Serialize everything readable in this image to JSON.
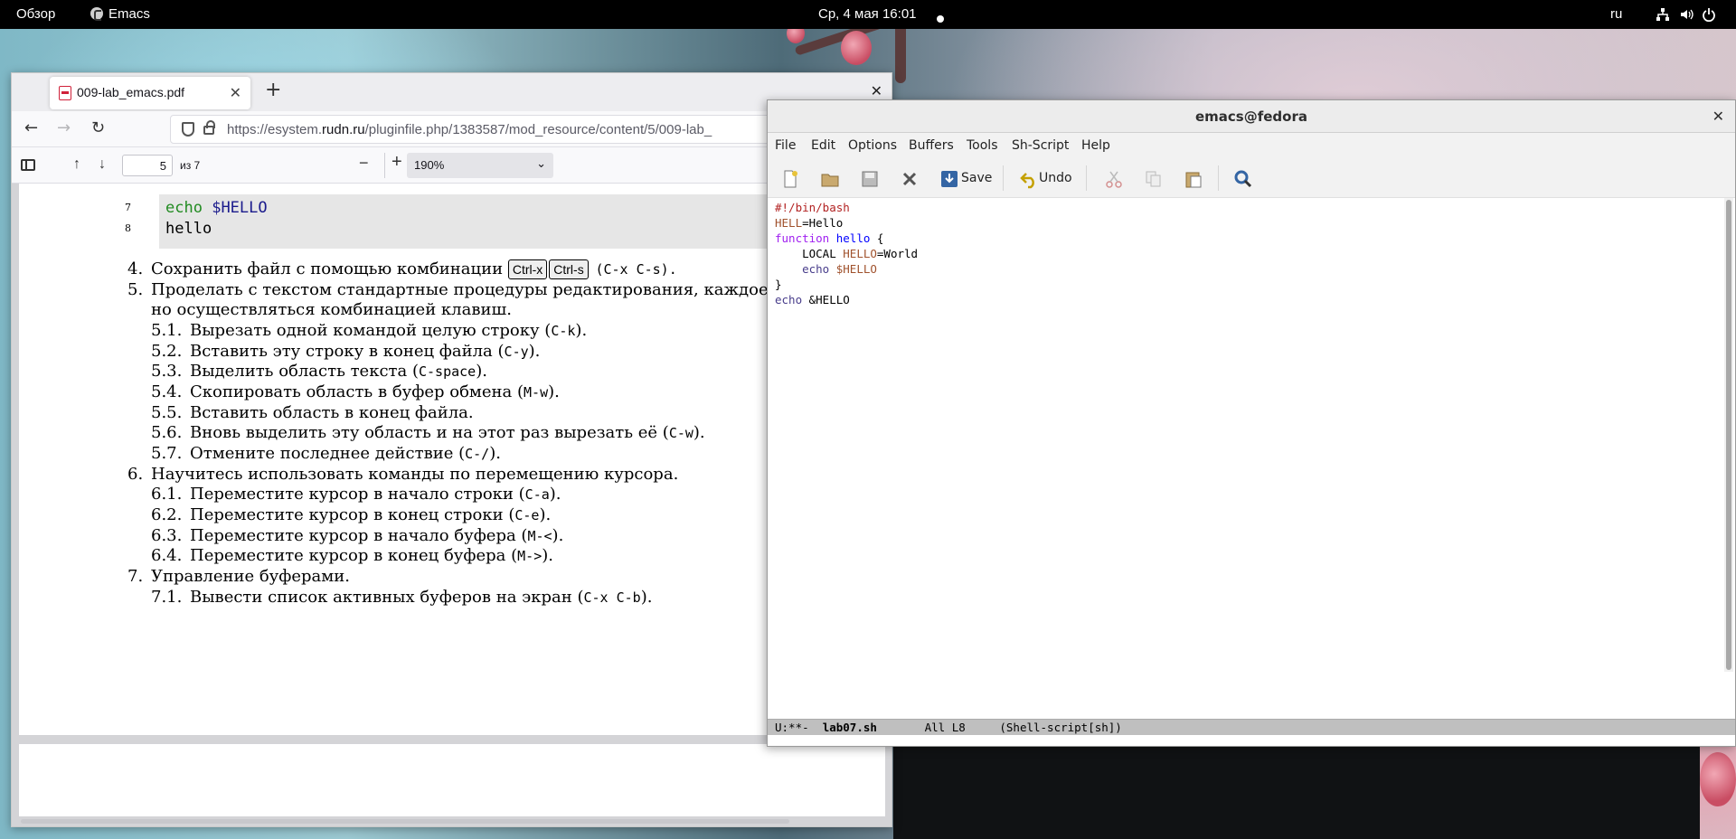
{
  "topbar": {
    "overview": "Обзор",
    "app_name": "Emacs",
    "clock": "Ср, 4 мая  16:01",
    "language": "ru"
  },
  "firefox": {
    "tab_title": "009-lab_emacs.pdf",
    "url_prefix": "https://esystem.",
    "url_domain": "rudn.ru",
    "url_rest": "/pluginfile.php/1383587/mod_resource/content/5/009-lab_",
    "page_number": "5",
    "page_of": "из 7",
    "zoom": "190%"
  },
  "pdf": {
    "code_lines": [
      {
        "num": "7",
        "cmd": "echo",
        "arg": "$HELLO"
      },
      {
        "num": "8",
        "text": "hello"
      }
    ],
    "items": [
      {
        "num": "4.",
        "text": "Сохранить файл с помощью комбинации",
        "keys": [
          "Ctrl-x",
          "Ctrl-s"
        ],
        "code": "(C-x C-s)."
      },
      {
        "num": "5.",
        "text": "Проделать с текстом стандартные процедуры редактирования, каждое дейс",
        "text2": "но осуществляться комбинацией клавиш."
      },
      {
        "num": "5.1.",
        "text": "Вырезать одной командой целую строку (",
        "code": "C-k",
        "tail": ")."
      },
      {
        "num": "5.2.",
        "text": "Вставить эту строку в конец файла (",
        "code": "C-y",
        "tail": ")."
      },
      {
        "num": "5.3.",
        "text": "Выделить область текста (",
        "code": "C-space",
        "tail": ")."
      },
      {
        "num": "5.4.",
        "text": "Скопировать область в буфер обмена (",
        "code": "M-w",
        "tail": ")."
      },
      {
        "num": "5.5.",
        "text": "Вставить область в конец файла."
      },
      {
        "num": "5.6.",
        "text": "Вновь выделить эту область и на этот раз вырезать её (",
        "code": "C-w",
        "tail": ")."
      },
      {
        "num": "5.7.",
        "text": "Отмените последнее действие (",
        "code": "C-/",
        "tail": ")."
      },
      {
        "num": "6.",
        "text": "Научитесь использовать команды по перемещению курсора."
      },
      {
        "num": "6.1.",
        "text": "Переместите курсор в начало строки (",
        "code": "C-a",
        "tail": ")."
      },
      {
        "num": "6.2.",
        "text": "Переместите курсор в конец строки (",
        "code": "C-e",
        "tail": ")."
      },
      {
        "num": "6.3.",
        "text": "Переместите курсор в начало буфера (",
        "code": "M-<",
        "tail": ")."
      },
      {
        "num": "6.4.",
        "text": "Переместите курсор в конец буфера (",
        "code": "M->",
        "tail": ")."
      },
      {
        "num": "7.",
        "text": "Управление буферами."
      },
      {
        "num": "7.1.",
        "text": "Вывести список активных буферов на экран (",
        "code": "C-x C-b",
        "tail": ")."
      }
    ]
  },
  "emacs": {
    "title": "emacs@fedora",
    "menu": [
      "File",
      "Edit",
      "Options",
      "Buffers",
      "Tools",
      "Sh-Script",
      "Help"
    ],
    "toolbar": {
      "save": "Save",
      "undo": "Undo"
    },
    "source": {
      "line1": "#!/bin/bash",
      "l2_var": "HELL",
      "l2_rest": "=Hello",
      "l3_kw": "function",
      "l3_fn": "hello",
      "l3_rest": " {",
      "l4_pre": "    LOCAL ",
      "l4_var": "HELLO",
      "l4_rest": "=World",
      "l5_pre": "    ",
      "l5_cmd": "echo",
      "l5_sp": " ",
      "l5_var": "$HELLO",
      "line6": "}",
      "l7_cmd": "echo",
      "l7_rest": " &HELLO"
    },
    "modeline": {
      "status": "U:**-  ",
      "buffer": "lab07.sh",
      "position": "       All L8     ",
      "mode": "(Shell-script[sh])"
    }
  },
  "colors": {
    "emacs_comment": "#b22222",
    "emacs_keyword": "#a020f0",
    "emacs_function": "#0000ff",
    "emacs_variable": "#a0522d",
    "emacs_builtin": "#483d8b"
  }
}
